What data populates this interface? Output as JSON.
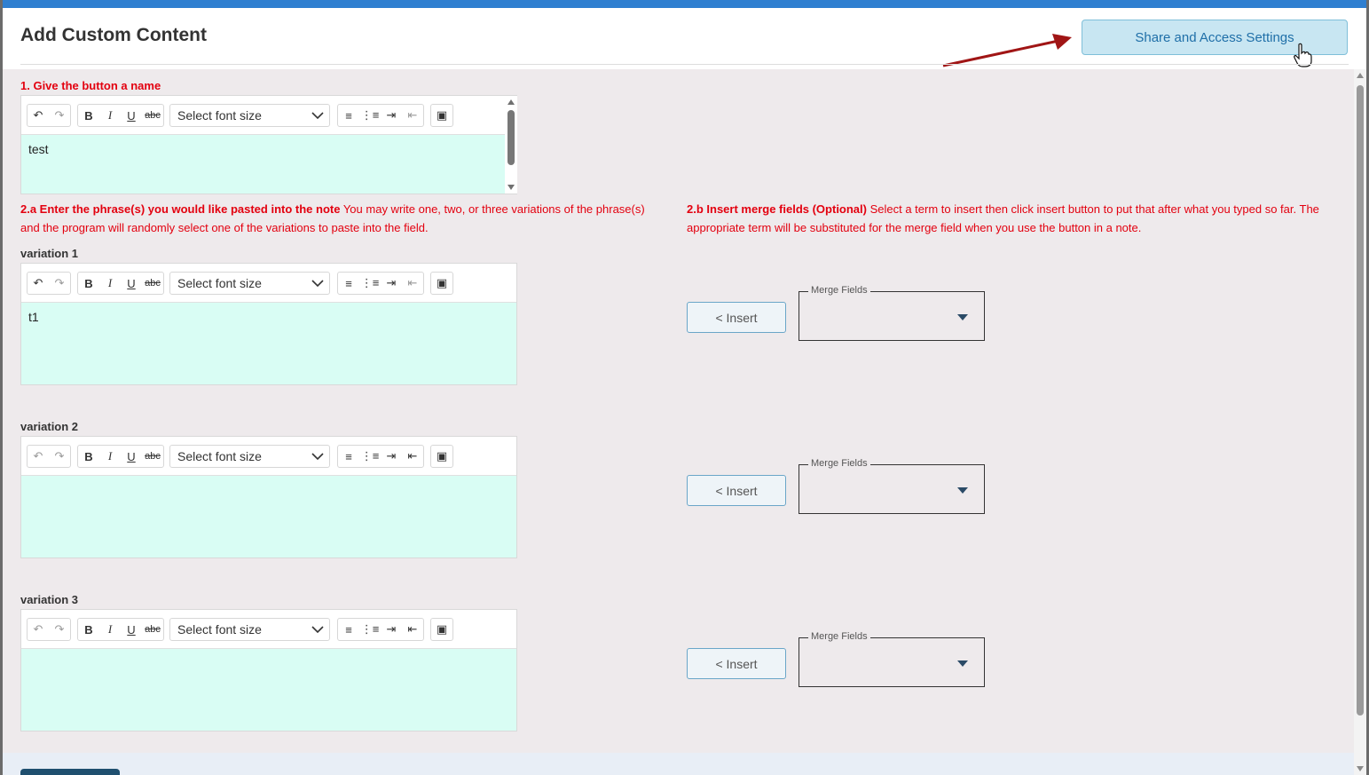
{
  "dialog": {
    "title": "Add Custom Content",
    "share_button": "Share and Access Settings"
  },
  "step1": {
    "label": "1. Give the button a name",
    "value": "test"
  },
  "step2a": {
    "label_bold": "2.a Enter the phrase(s) you would like pasted into the note",
    "label_rest": " You may write one, two, or three variations of the phrase(s) and the program will randomly select one of the variations to paste into the field."
  },
  "step2b": {
    "label_bold": "2.b Insert merge fields (Optional)",
    "label_rest": " Select a term to insert then click insert button to put that after what you typed so far. The appropriate term will be substituted for the merge field when you use the button in a note."
  },
  "toolbar": {
    "font_size_placeholder": "Select font size",
    "bold": "B",
    "italic": "I",
    "underline": "U",
    "strike": "abc"
  },
  "variations": [
    {
      "label": "variation 1",
      "value": "t1"
    },
    {
      "label": "variation 2",
      "value": ""
    },
    {
      "label": "variation 3",
      "value": ""
    }
  ],
  "insert_label": "< Insert",
  "merge_fields_label": "Merge Fields",
  "colors": {
    "accent_red": "#e3000f",
    "editor_bg": "#d9fdf4",
    "share_bg": "#c8e6f2",
    "top_bar": "#2f7fd0"
  }
}
